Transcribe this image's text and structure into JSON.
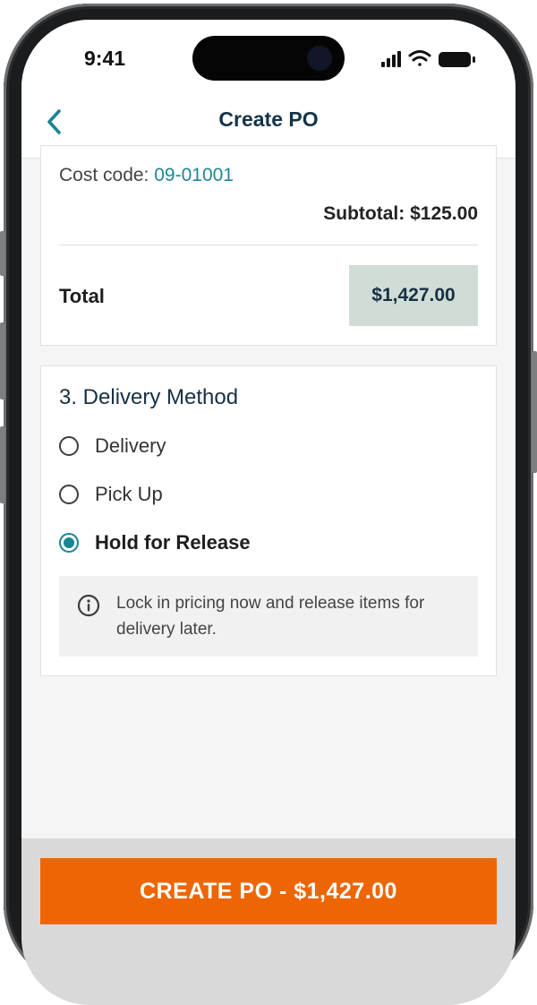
{
  "status_bar": {
    "time": "9:41",
    "icons": [
      "signal-icon",
      "wifi-icon",
      "battery-icon"
    ]
  },
  "nav": {
    "back_icon": "chevron-left-icon",
    "title": "Create PO"
  },
  "line_item": {
    "cost_code_label": "Cost code: ",
    "cost_code_value": "09-01001",
    "subtotal": "Subtotal: $125.00"
  },
  "order": {
    "total_label": "Total",
    "total_value": "$1,427.00"
  },
  "delivery": {
    "title": "3. Delivery Method",
    "options": [
      {
        "label": "Delivery",
        "selected": false
      },
      {
        "label": "Pick Up",
        "selected": false
      },
      {
        "label": "Hold for Release",
        "selected": true
      }
    ],
    "info_icon": "info-icon",
    "info_text": "Lock in pricing now and release items for delivery later."
  },
  "footer": {
    "cta_label": "CREATE PO - $1,427.00"
  },
  "colors": {
    "accent_teal": "#198595",
    "cta_orange": "#EE6603",
    "total_highlight": "#CFDDD6",
    "title_navy": "#143349"
  }
}
